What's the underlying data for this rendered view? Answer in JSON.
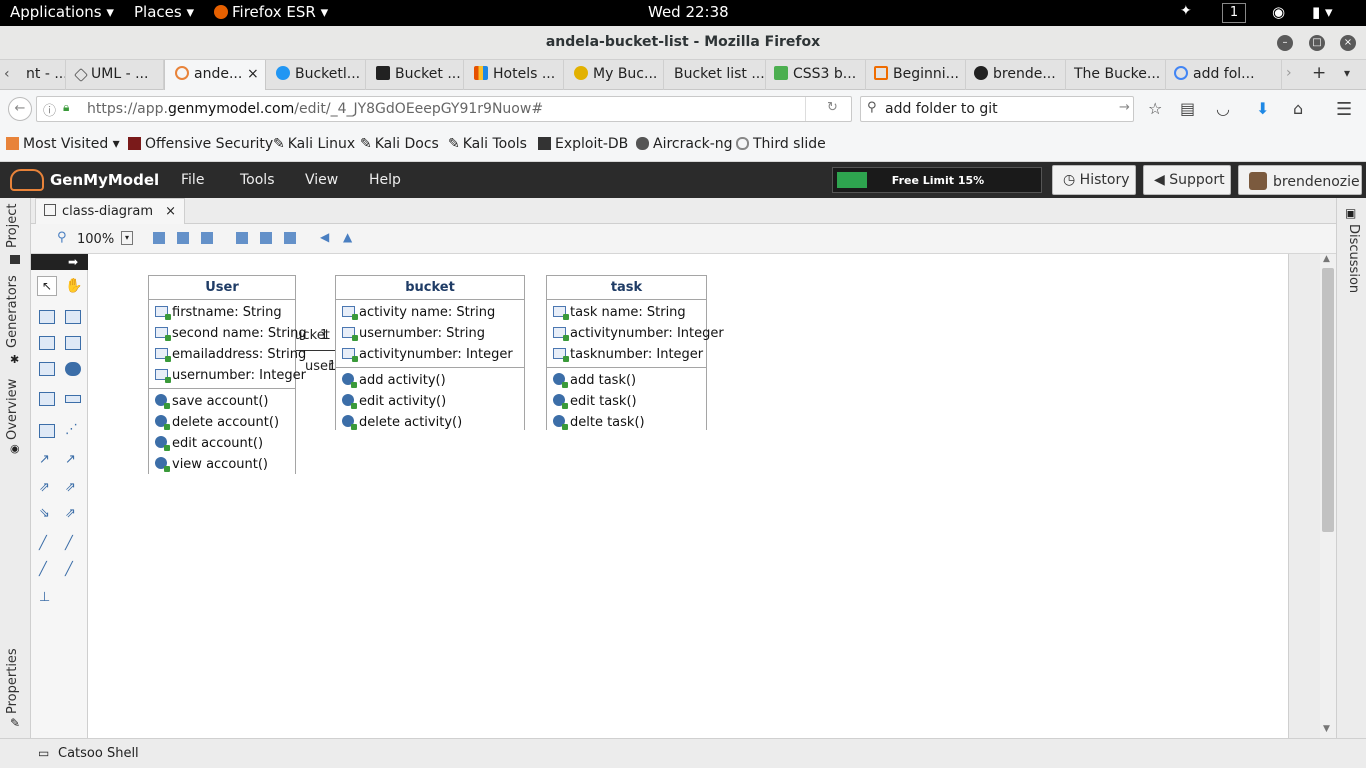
{
  "topbar": {
    "applications": "Applications",
    "places": "Places",
    "firefox": "Firefox ESR",
    "clock": "Wed 22:38",
    "workspace": "1"
  },
  "window": {
    "title": "andela-bucket-list - Mozilla Firefox"
  },
  "tabs": [
    {
      "label": "nt - ...",
      "color": "#888888"
    },
    {
      "label": "UML - ...",
      "color": "#666666"
    },
    {
      "label": "ande...",
      "color": "#e8833a"
    },
    {
      "label": "Bucketl...",
      "color": "#2196f3"
    },
    {
      "label": "Bucket ...",
      "color": "#222222"
    },
    {
      "label": "Hotels ...",
      "color": "#e65100"
    },
    {
      "label": "My Buc...",
      "color": "#e2b100"
    },
    {
      "label": "Bucket list ...",
      "color": "#dddddd"
    },
    {
      "label": "CSS3 b...",
      "color": "#4caf50"
    },
    {
      "label": "Beginni...",
      "color": "#ef6c00"
    },
    {
      "label": "brende...",
      "color": "#222222"
    },
    {
      "label": "The Bucke...",
      "color": "#dddddd"
    },
    {
      "label": "add fol...",
      "color": "#4285f4"
    }
  ],
  "nav": {
    "url_prefix": "https://app.",
    "url_domain": "genmymodel.com",
    "url_path": "/edit/_4_JY8GdOEeepGY91r9Nuow#",
    "search_value": "add folder to git"
  },
  "bookmarks": [
    {
      "label": "Most Visited ▾",
      "color": "#e8833a"
    },
    {
      "label": "Offensive Security",
      "color": "#7a1a1a"
    },
    {
      "label": "Kali Linux",
      "color": "#333333"
    },
    {
      "label": "Kali Docs",
      "color": "#333333"
    },
    {
      "label": "Kali Tools",
      "color": "#333333"
    },
    {
      "label": "Exploit-DB",
      "color": "#333333"
    },
    {
      "label": "Aircrack-ng",
      "color": "#555555"
    },
    {
      "label": "Third slide",
      "color": "#888888"
    }
  ],
  "app": {
    "logo": "GenMyModel",
    "menus": [
      "File",
      "Tools",
      "View",
      "Help"
    ],
    "limit_label": "Free Limit 15%",
    "limit_fraction": 0.15,
    "history": "History",
    "support": "Support",
    "user": "brendenozie"
  },
  "editor": {
    "doc_tab": "class-diagram",
    "zoom": "100%",
    "left_tabs": [
      "Project",
      "Generators",
      "Overview",
      "Properties"
    ],
    "right_tab": "Discussion",
    "status": "Catsoo Shell"
  },
  "diagram": {
    "classes": [
      {
        "name": "User",
        "attributes": [
          "firstname: String",
          "second name: String",
          "emailaddress: String",
          "usernumber: Integer"
        ],
        "operations": [
          "save account()",
          "delete account()",
          "edit account()",
          "view account()"
        ]
      },
      {
        "name": "bucket",
        "attributes": [
          "activity name: String",
          "usernumber: String",
          "activitynumber: Integer"
        ],
        "operations": [
          "add activity()",
          "edit activity()",
          "delete activity()"
        ]
      },
      {
        "name": "task",
        "attributes": [
          "task name: String",
          "activitynumber: Integer",
          "tasknumber: Integer"
        ],
        "operations": [
          "add task()",
          "edit task()",
          "delte task()"
        ]
      }
    ],
    "association": {
      "end_a": "bucket",
      "mult_a": "1",
      "end_b": "user",
      "mult_b": "1"
    }
  }
}
